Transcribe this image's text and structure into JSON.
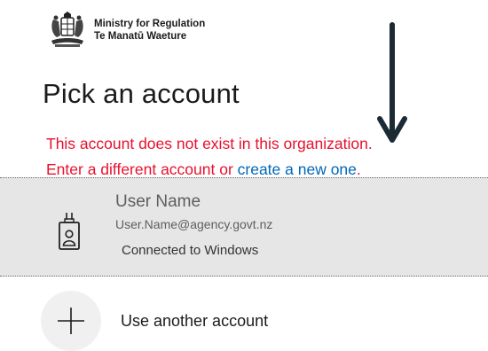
{
  "header": {
    "org_line1": "Ministry for Regulation",
    "org_line2": "Te Manatū Waeture",
    "crest_icon": "nz-coat-of-arms-icon"
  },
  "page": {
    "title": "Pick an account"
  },
  "error": {
    "line1": "This account does not exist in this organization.",
    "line2_prefix": "Enter a different account or ",
    "link_text": "create a new one",
    "line2_suffix": ".",
    "error_color": "#e8112d",
    "link_color": "#0067b8"
  },
  "account": {
    "icon": "id-badge-icon",
    "name": "User Name",
    "email": "User.Name@agency.govt.nz",
    "status": "Connected to Windows"
  },
  "another": {
    "icon": "plus-icon",
    "label": "Use another account"
  },
  "annotation": {
    "icon": "down-arrow-icon",
    "color": "#1b2a33"
  }
}
